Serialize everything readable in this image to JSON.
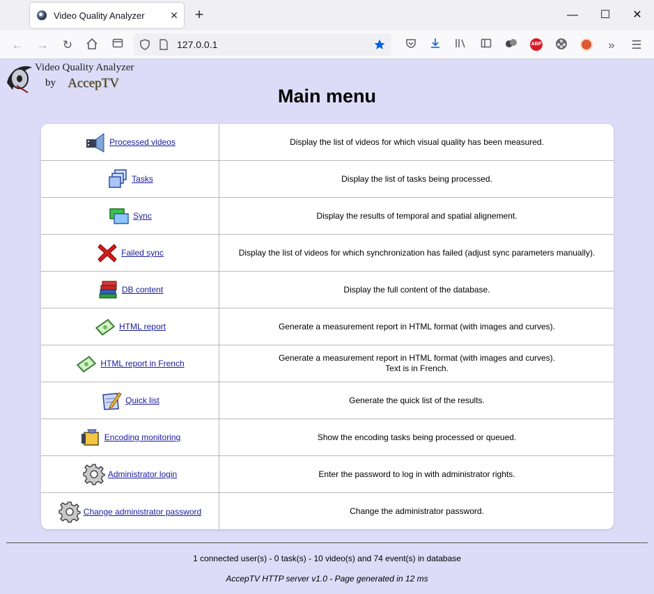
{
  "browser": {
    "tab_title": "Video Quality Analyzer",
    "tab_close": "✕",
    "new_tab": "+",
    "url": "127.0.0.1",
    "window": {
      "minimize": "—",
      "maximize": "☐",
      "close": "✕"
    },
    "nav": {
      "back": "←",
      "forward": "→",
      "reload": "↻"
    }
  },
  "logo": {
    "title": "Video Quality Analyzer",
    "by": "by",
    "brand": "AccepTV"
  },
  "page": {
    "title": "Main menu"
  },
  "menu": [
    {
      "label": "Processed videos",
      "icon": "video-speaker-icon",
      "description": "Display the list of videos for which visual quality has been measured."
    },
    {
      "label": "Tasks",
      "icon": "tasks-windows-icon",
      "description": "Display the list of tasks being processed."
    },
    {
      "label": "Sync",
      "icon": "sync-windows-icon",
      "description": "Display the results of temporal and spatial alignement."
    },
    {
      "label": "Failed sync",
      "icon": "red-x-icon",
      "description": "Display the list of videos for which synchronization has failed (adjust sync parameters manually)."
    },
    {
      "label": "DB content",
      "icon": "books-icon",
      "description": "Display the full content of the database."
    },
    {
      "label": "HTML report",
      "icon": "money-report-icon",
      "description": "Generate a measurement report in HTML format (with images and curves)."
    },
    {
      "label": "HTML report in French",
      "icon": "money-report-icon",
      "description": "Generate a measurement report in HTML format (with images and curves).",
      "description2": "Text is in French."
    },
    {
      "label": "Quick list",
      "icon": "notepad-pencil-icon",
      "description": "Generate the quick list of the results."
    },
    {
      "label": "Encoding monitoring",
      "icon": "encoding-monitor-icon",
      "description": "Show the encoding tasks being processed or queued."
    },
    {
      "label": "Administrator login",
      "icon": "gear-icon",
      "description": "Enter the password to log in with administrator rights."
    },
    {
      "label": "Change administrator password",
      "icon": "gear-icon",
      "description": "Change the administrator password."
    }
  ],
  "footer": {
    "stats": "1 connected user(s) - 0 task(s) - 10 video(s) and 74 event(s) in database",
    "server": "AccepTV HTTP server v1.0 - Page generated in 12 ms"
  },
  "colors": {
    "page_bg": "#dcdcf8",
    "link": "#1a1a9c",
    "bookmark_star": "#0060df",
    "abp_red": "#d81b29"
  }
}
